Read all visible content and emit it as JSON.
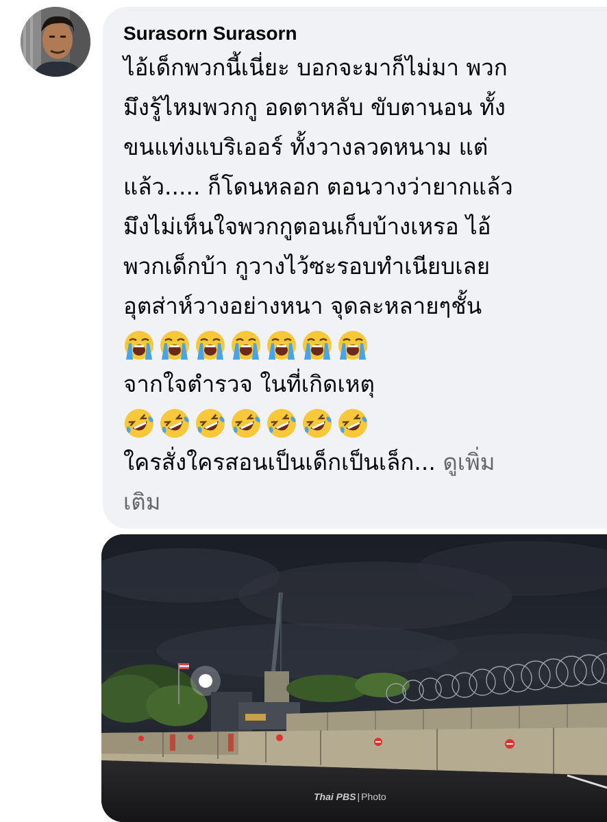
{
  "comment": {
    "author": "Surasorn Surasorn",
    "lines": [
      "ไอ้เด็กพวกนี้เนี่ยะ บอกจะมาก็ไม่มา พวก",
      "มึงรู้ไหมพวกกู อดตาหลับ ขับตานอน ทั้ง",
      "ขนแท่งแบริเออร์ ทั้งวางลวดหนาม แต่",
      "แล้ว..... ก็โดนหลอก ตอนวางว่ายากแล้ว",
      "มึงไม่เห็นใจพวกกูตอนเก็บบ้างเหรอ ไอ้",
      "พวกเด็กบ้า กูวางไว้ซะรอบทำเนียบเลย",
      "อุตส่าห์วางอย่างหนา จุดละหลายๆชั้น"
    ],
    "emoji_row_1": "loudly-crying-face x7",
    "line_after_emoji_1": "จากใจตำรวจ ในที่เกิดเหตุ",
    "emoji_row_2": "rolling-on-the-floor-laughing x7",
    "last_line": "ใครสั่งใครสอนเป็นเด็กเป็นเล็ก...",
    "see_more_part1": "ดูเพิ่ม",
    "see_more_part2": "เติม"
  },
  "photo": {
    "watermark_brand": "Thai PBS",
    "watermark_separator": "|",
    "watermark_label": "Photo"
  },
  "colors": {
    "bubble": "#f0f2f5",
    "text": "#050505",
    "see_more": "#65676b"
  },
  "icons": {
    "avatar": "profile-photo",
    "emoji_1": "loudly-crying-face",
    "emoji_2": "rolling-on-the-floor-laughing"
  }
}
